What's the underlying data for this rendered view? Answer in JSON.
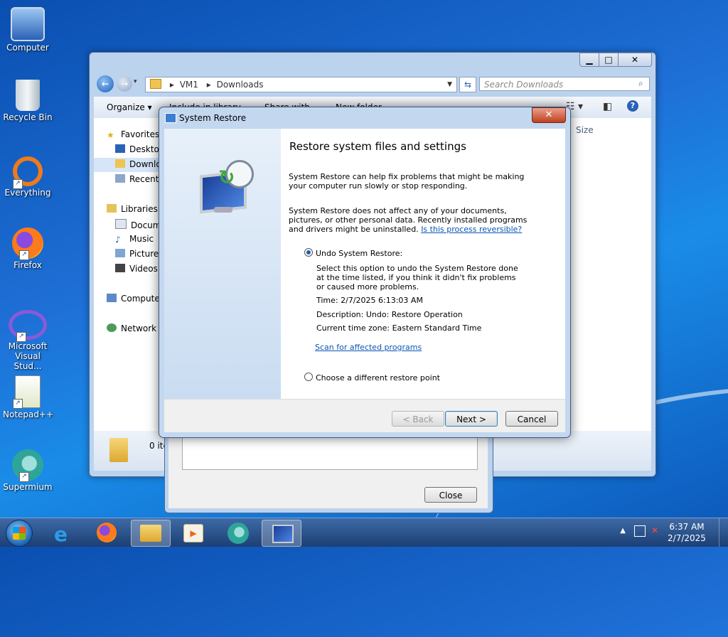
{
  "desktop": {
    "icons": [
      {
        "label": "Computer"
      },
      {
        "label": "Recycle Bin"
      },
      {
        "label": "Everything"
      },
      {
        "label": "Firefox"
      },
      {
        "label": "Microsoft Visual Stud..."
      },
      {
        "label": "Notepad++"
      },
      {
        "label": "Supermium"
      }
    ]
  },
  "explorer": {
    "address": [
      "VM1",
      "Downloads"
    ],
    "search_placeholder": "Search Downloads",
    "toolbar": {
      "organize": "Organize",
      "include": "Include in library",
      "share": "Share with",
      "newfolder": "New folder"
    },
    "nav": {
      "favorites": "Favorites",
      "desktop": "Desktop",
      "downloads": "Downloads",
      "recent": "Recent Places",
      "libraries": "Libraries",
      "documents": "Documents",
      "music": "Music",
      "pictures": "Pictures",
      "videos": "Videos",
      "computer": "Computer",
      "network": "Network"
    },
    "column_size": "Size",
    "status_items": "0 items"
  },
  "back_dialog": {
    "close_label": "Close"
  },
  "system_restore": {
    "title": "System Restore",
    "heading": "Restore system files and settings",
    "para1": "System Restore can help fix problems that might be making your computer run slowly or stop responding.",
    "para2": "System Restore does not affect any of your documents, pictures, or other personal data. Recently installed programs and drivers might be uninstalled.",
    "reversible_link": "Is this process reversible?",
    "undo_label": "Undo System Restore:",
    "undo_desc": "Select this option to undo the System Restore done at the time listed, if you think it didn't fix problems or caused more problems.",
    "time": "Time: 2/7/2025 6:13:03 AM",
    "description": "Description: Undo: Restore Operation",
    "timezone": "Current time zone: Eastern Standard Time",
    "scan_link": "Scan for affected programs",
    "different_label": "Choose a different restore point",
    "back_btn": "< Back",
    "next_btn": "Next >",
    "cancel_btn": "Cancel"
  },
  "taskbar": {
    "time": "6:37 AM",
    "date": "2/7/2025"
  }
}
